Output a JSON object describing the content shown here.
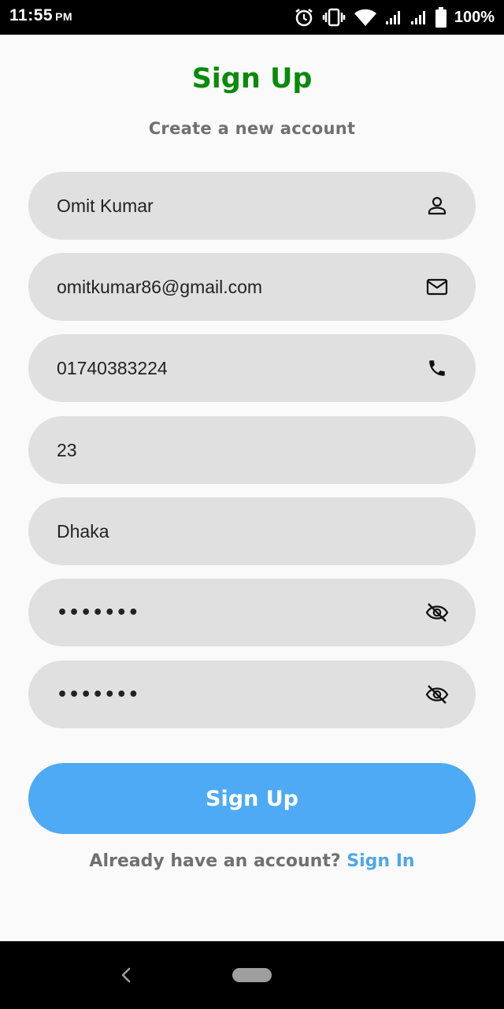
{
  "status_bar": {
    "time": "11:55",
    "ampm": "PM",
    "battery": "100%",
    "icons": [
      "alarm-icon",
      "vibrate-icon",
      "wifi-icon",
      "signal-icon",
      "signal-icon",
      "battery-icon"
    ]
  },
  "header": {
    "title": "Sign Up",
    "subtitle": "Create a new account"
  },
  "form": {
    "name": {
      "value": "Omit Kumar",
      "icon": "person-icon"
    },
    "email": {
      "value": "omitkumar86@gmail.com",
      "icon": "mail-icon"
    },
    "phone": {
      "value": "01740383224",
      "icon": "phone-icon"
    },
    "age": {
      "value": "23"
    },
    "city": {
      "value": "Dhaka"
    },
    "password": {
      "value": "•••••••",
      "icon": "visibility-off-icon"
    },
    "confirm_password": {
      "value": "•••••••",
      "icon": "visibility-off-icon"
    }
  },
  "actions": {
    "signup_label": "Sign Up",
    "signin_prompt": "Already have an account?",
    "signin_link": "Sign In"
  },
  "colors": {
    "title": "#0a8a0a",
    "button": "#4eaaf4",
    "link": "#4ea6e8",
    "field_bg": "#e0e0e0",
    "muted_text": "#707070"
  }
}
